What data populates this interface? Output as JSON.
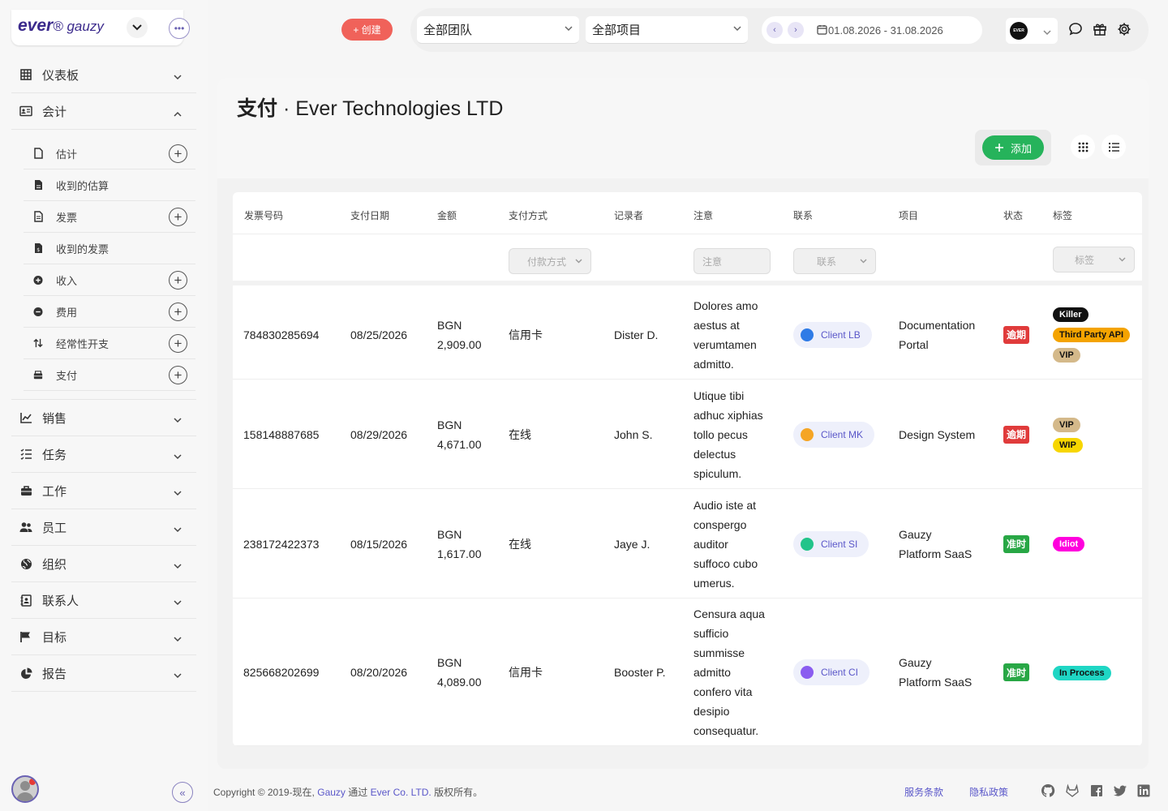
{
  "brand": {
    "logo_main": "ever",
    "logo_sub": "gauzy"
  },
  "sidebar": {
    "items": [
      {
        "label": "仪表板",
        "icon": "grid-icon"
      },
      {
        "label": "会计",
        "icon": "id-card-icon"
      },
      {
        "label": "销售",
        "icon": "chart-line-icon"
      },
      {
        "label": "任务",
        "icon": "tasks-icon"
      },
      {
        "label": "工作",
        "icon": "briefcase-icon"
      },
      {
        "label": "员工",
        "icon": "users-icon"
      },
      {
        "label": "组织",
        "icon": "globe-icon"
      },
      {
        "label": "联系人",
        "icon": "contact-book-icon"
      },
      {
        "label": "目标",
        "icon": "flag-icon"
      },
      {
        "label": "报告",
        "icon": "pie-chart-icon"
      }
    ],
    "sub_items": [
      {
        "label": "估计",
        "has_add": true
      },
      {
        "label": "收到的估算",
        "has_add": false
      },
      {
        "label": "发票",
        "has_add": true
      },
      {
        "label": "收到的发票",
        "has_add": false
      },
      {
        "label": "收入",
        "has_add": true
      },
      {
        "label": "费用",
        "has_add": true
      },
      {
        "label": "经常性开支",
        "has_add": true
      },
      {
        "label": "支付",
        "has_add": true
      }
    ]
  },
  "header": {
    "create_label": "+ 创建",
    "team_select": "全部团队",
    "project_select": "全部项目",
    "date_range": "01.08.2026 - 31.08.2026",
    "org_logo_text": "EVER"
  },
  "page": {
    "title_prefix": "支付",
    "title_sep": " · ",
    "title_org": "Ever Technologies LTD",
    "add_label": "添加"
  },
  "table": {
    "columns": [
      "发票号码",
      "支付日期",
      "金额",
      "支付方式",
      "记录者",
      "注意",
      "联系",
      "项目",
      "状态",
      "标签"
    ],
    "filters": {
      "payment_method": "付款方式",
      "note": "注意",
      "contact": "联系",
      "tags": "标签"
    },
    "rows": [
      {
        "invoice": "784830285694",
        "date": "08/25/2026",
        "currency": "BGN",
        "amount": "2,909.00",
        "method": "信用卡",
        "recorder": "Dister D.",
        "note": [
          "Dolores amo",
          "aestus at",
          "verumtamen",
          "admitto."
        ],
        "client": "Client LB",
        "client_color": "#2f7be6",
        "project": [
          "Documentation",
          "Portal"
        ],
        "status": "逾期",
        "status_color": "#e03b3b",
        "tags": [
          {
            "label": "Killer",
            "bg": "#111111",
            "fg": "#ffffff"
          },
          {
            "label": "Third Party API",
            "bg": "#f4a300",
            "fg": "#111111"
          },
          {
            "label": "VIP",
            "bg": "#d4b98a",
            "fg": "#111111"
          }
        ]
      },
      {
        "invoice": "158148887685",
        "date": "08/29/2026",
        "currency": "BGN",
        "amount": "4,671.00",
        "method": "在线",
        "recorder": "John S.",
        "note": [
          "Utique tibi",
          "adhuc xiphias",
          "tollo pecus",
          "delectus",
          "spiculum."
        ],
        "client": "Client MK",
        "client_color": "#f5a524",
        "project": [
          "Design System"
        ],
        "status": "逾期",
        "status_color": "#e03b3b",
        "tags": [
          {
            "label": "VIP",
            "bg": "#d4b98a",
            "fg": "#111111"
          },
          {
            "label": "WIP",
            "bg": "#f7d600",
            "fg": "#111111"
          }
        ]
      },
      {
        "invoice": "238172422373",
        "date": "08/15/2026",
        "currency": "BGN",
        "amount": "1,617.00",
        "method": "在线",
        "recorder": "Jaye J.",
        "note": [
          "Audio iste at",
          "conspergo",
          "auditor",
          "suffoco cubo",
          "umerus."
        ],
        "client": "Client SI",
        "client_color": "#22c48a",
        "project": [
          "Gauzy",
          "Platform SaaS"
        ],
        "status": "准时",
        "status_color": "#28a745",
        "tags": [
          {
            "label": "Idiot",
            "bg": "#ff00dd",
            "fg": "#ffffff"
          }
        ]
      },
      {
        "invoice": "825668202699",
        "date": "08/20/2026",
        "currency": "BGN",
        "amount": "4,089.00",
        "method": "信用卡",
        "recorder": "Booster P.",
        "note": [
          "Censura aqua",
          "sufficio",
          "summisse",
          "admitto",
          "confero vita",
          "desipio",
          "consequatur."
        ],
        "client": "Client CI",
        "client_color": "#8a5cf0",
        "project": [
          "Gauzy",
          "Platform SaaS"
        ],
        "status": "准时",
        "status_color": "#28a745",
        "tags": [
          {
            "label": "In Process",
            "bg": "#1fd6c4",
            "fg": "#111111"
          }
        ]
      }
    ]
  },
  "footer": {
    "copyright_prefix": "Copyright © 2019-现在, ",
    "gauzy": "Gauzy",
    "via": " 通过 ",
    "company": "Ever Co. LTD.",
    "rights": " 版权所有。",
    "terms": "服务条款",
    "privacy": "隐私政策"
  }
}
